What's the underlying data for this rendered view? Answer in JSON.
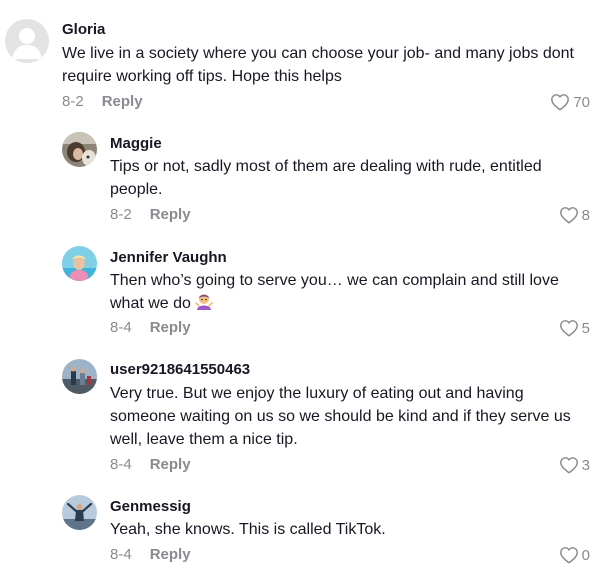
{
  "comments": [
    {
      "username": "Gloria",
      "text": "We live in a society where you can choose your job- and many jobs dont require working off tips. Hope this helps",
      "date": "8-2",
      "reply_label": "Reply",
      "likes": "70",
      "avatar_icon": "default-avatar-icon"
    },
    {
      "username": "Maggie",
      "text": "Tips or not, sadly most of them are dealing with rude, entitled people.",
      "date": "8-2",
      "reply_label": "Reply",
      "likes": "8",
      "avatar_icon": "profile-photo"
    },
    {
      "username": "Jennifer Vaughn",
      "text": "Then who’s going to serve you… we can complain and still love what we do",
      "emoji": "person-shrugging-emoji",
      "date": "8-4",
      "reply_label": "Reply",
      "likes": "5",
      "avatar_icon": "profile-photo"
    },
    {
      "username": "user9218641550463",
      "text": "Very true. But we enjoy the luxury of eating out and having someone waiting on us so we should be kind and if they serve us well, leave them a nice tip.",
      "date": "8-4",
      "reply_label": "Reply",
      "likes": "3",
      "avatar_icon": "profile-photo"
    },
    {
      "username": "Genmessig",
      "text": "Yeah, she knows. This is called TikTok.",
      "date": "8-4",
      "reply_label": "Reply",
      "likes": "0",
      "avatar_icon": "profile-photo"
    }
  ],
  "colors": {
    "text": "#161823",
    "secondary": "#8a8b91",
    "background": "#ffffff"
  }
}
